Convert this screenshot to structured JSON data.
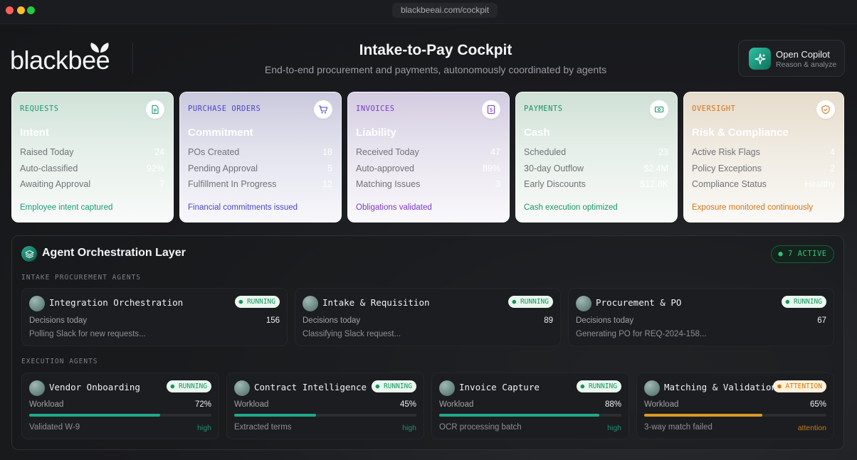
{
  "browser": {
    "url": "blackbeeai.com/cockpit"
  },
  "brand": {
    "logo_text": "blackbee"
  },
  "header": {
    "title": "Intake-to-Pay Cockpit",
    "subtitle": "End-to-end procurement and payments, autonomously coordinated by agents"
  },
  "copilot": {
    "label": "Open Copilot",
    "sublabel": "Reason & analyze",
    "icon": "sparkles-icon"
  },
  "stages": [
    {
      "category": "REQUESTS",
      "name": "Intent",
      "icon": "document-icon",
      "accent": "#1a9a76",
      "metrics": [
        {
          "label": "Raised Today",
          "value": "24"
        },
        {
          "label": "Auto-classified",
          "value": "92%"
        },
        {
          "label": "Awaiting Approval",
          "value": "7"
        }
      ],
      "footer": "Employee intent captured"
    },
    {
      "category": "PURCHASE ORDERS",
      "name": "Commitment",
      "icon": "cart-icon",
      "accent": "#4b45c9",
      "metrics": [
        {
          "label": "POs Created",
          "value": "18"
        },
        {
          "label": "Pending Approval",
          "value": "5"
        },
        {
          "label": "Fulfillment In Progress",
          "value": "12"
        }
      ],
      "footer": "Financial commitments issued"
    },
    {
      "category": "INVOICES",
      "name": "Liability",
      "icon": "invoice-dollar-icon",
      "accent": "#7c3bc7",
      "metrics": [
        {
          "label": "Received Today",
          "value": "47"
        },
        {
          "label": "Auto-approved",
          "value": "89%"
        },
        {
          "label": "Matching Issues",
          "value": "3"
        }
      ],
      "footer": "Obligations validated"
    },
    {
      "category": "PAYMENTS",
      "name": "Cash",
      "icon": "banknote-icon",
      "accent": "#1a9566",
      "metrics": [
        {
          "label": "Scheduled",
          "value": "23"
        },
        {
          "label": "30-day Outflow",
          "value": "$2.4M"
        },
        {
          "label": "Early Discounts",
          "value": "$12.8K"
        }
      ],
      "footer": "Cash execution optimized"
    },
    {
      "category": "OVERSIGHT",
      "name": "Risk & Compliance",
      "icon": "shield-check-icon",
      "accent": "#d3741a",
      "metrics": [
        {
          "label": "Active Risk Flags",
          "value": "4"
        },
        {
          "label": "Policy Exceptions",
          "value": "2"
        },
        {
          "label": "Compliance Status",
          "value": "Healthy"
        }
      ],
      "footer": "Exposure monitored continuously"
    }
  ],
  "orchestration": {
    "title": "Agent Orchestration Layer",
    "active_badge": "7 ACTIVE",
    "intake_label": "INTAKE PROCUREMENT AGENTS",
    "execution_label": "EXECUTION AGENTS",
    "intake_agents": [
      {
        "name": "Integration Orchestration",
        "status": "RUNNING",
        "metric_label": "Decisions today",
        "metric_value": "156",
        "activity": "Polling Slack for new requests..."
      },
      {
        "name": "Intake & Requisition",
        "status": "RUNNING",
        "metric_label": "Decisions today",
        "metric_value": "89",
        "activity": "Classifying Slack request..."
      },
      {
        "name": "Procurement & PO",
        "status": "RUNNING",
        "metric_label": "Decisions today",
        "metric_value": "67",
        "activity": "Generating PO for REQ-2024-158..."
      }
    ],
    "execution_agents": [
      {
        "name": "Vendor Onboarding",
        "status": "RUNNING",
        "metric_label": "Workload",
        "workload": "72%",
        "workload_fraction": 0.72,
        "activity": "Validated W-9",
        "priority": "high",
        "bar_color": "#1fa88a"
      },
      {
        "name": "Contract Intelligence",
        "status": "RUNNING",
        "metric_label": "Workload",
        "workload": "45%",
        "workload_fraction": 0.45,
        "activity": "Extracted terms",
        "priority": "high",
        "bar_color": "#1fa88a"
      },
      {
        "name": "Invoice Capture",
        "status": "RUNNING",
        "metric_label": "Workload",
        "workload": "88%",
        "workload_fraction": 0.88,
        "activity": "OCR processing batch",
        "priority": "high",
        "bar_color": "#1fa88a"
      },
      {
        "name": "Matching & Validation",
        "status": "ATTENTION",
        "metric_label": "Workload",
        "workload": "65%",
        "workload_fraction": 0.65,
        "activity": "3-way match failed",
        "priority": "attention",
        "bar_color": "#d99a25"
      }
    ]
  }
}
